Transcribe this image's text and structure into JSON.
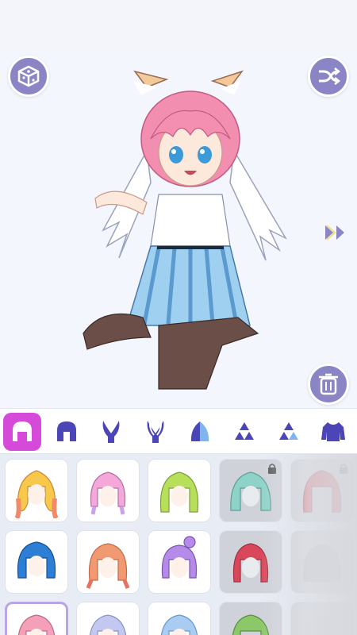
{
  "toolbar": {
    "dice_icon": "dice-icon",
    "shuffle_icon": "shuffle-icon",
    "trash_icon": "trash-icon",
    "next_icon": "double-chevron-right-icon"
  },
  "categories": [
    {
      "name": "hair-front",
      "active": true
    },
    {
      "name": "hair-back",
      "active": false
    },
    {
      "name": "ears",
      "active": false
    },
    {
      "name": "ears-alt",
      "active": false
    },
    {
      "name": "accessory",
      "active": false
    },
    {
      "name": "hair-clip",
      "active": false
    },
    {
      "name": "hair-clip-alt",
      "active": false
    },
    {
      "name": "top",
      "active": false
    }
  ],
  "hair_items": [
    {
      "color": "#f7c84a",
      "accent": "#f08a6a",
      "locked": false,
      "selected": false
    },
    {
      "color": "#f4a7d8",
      "accent": "#c9a2e8",
      "locked": false,
      "selected": false
    },
    {
      "color": "#b8df5a",
      "accent": "#8fd06a",
      "locked": false,
      "selected": false
    },
    {
      "color": "#8fd3c8",
      "accent": "#7fc6c0",
      "locked": true,
      "selected": false
    },
    {
      "color": "#d8464a",
      "accent": "#c23c40",
      "locked": true,
      "selected": false
    },
    {
      "color": "#2d7fd6",
      "accent": "#1f5fb0",
      "locked": false,
      "selected": false
    },
    {
      "color": "#f19a72",
      "accent": "#e97060",
      "locked": false,
      "selected": false
    },
    {
      "color": "#b58ae8",
      "accent": "#9a6ed6",
      "locked": false,
      "selected": false
    },
    {
      "color": "#d9485a",
      "accent": "#b83a4c",
      "locked": true,
      "selected": false
    },
    {
      "color": "#bbbbbb",
      "accent": "#aaaaaa",
      "locked": true,
      "selected": false
    },
    {
      "color": "#f4a0b8",
      "accent": "#ee8aa8",
      "locked": false,
      "selected": true
    },
    {
      "color": "#c3c8f0",
      "accent": "#a9b0e6",
      "locked": false,
      "selected": false
    },
    {
      "color": "#a9cdf2",
      "accent": "#8fb8ea",
      "locked": false,
      "selected": false
    },
    {
      "color": "#8cc86a",
      "accent": "#6fb050",
      "locked": true,
      "selected": false
    },
    {
      "color": "#cccccc",
      "accent": "#bbbbbb",
      "locked": true,
      "selected": false
    }
  ],
  "colors": {
    "button_bg": "#8a86c6",
    "active_tab": "#d54ad9",
    "icon_color": "#4b45b8"
  }
}
